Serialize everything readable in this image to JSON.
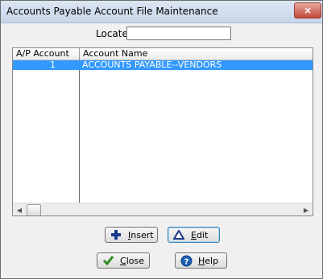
{
  "window": {
    "title": "Accounts Payable Account File Maintenance",
    "close_glyph": "×"
  },
  "locate": {
    "label": "Locate:",
    "value": ""
  },
  "grid": {
    "columns": [
      "A/P Account",
      "Account Name"
    ],
    "rows": [
      {
        "account": "1",
        "name": "ACCOUNTS PAYABLE--VENDORS",
        "selected": true
      }
    ],
    "scroll_left_glyph": "◀",
    "scroll_right_glyph": "▶"
  },
  "buttons": {
    "insert": {
      "first": "I",
      "rest": "nsert",
      "icon": "plus-icon"
    },
    "edit": {
      "first": "E",
      "rest": "dit",
      "icon": "triangle-icon"
    },
    "close": {
      "first": "C",
      "rest": "lose",
      "icon": "checkmark-icon"
    },
    "help": {
      "first": "H",
      "rest": "elp",
      "icon": "question-icon"
    }
  },
  "colors": {
    "selection": "#3399ff",
    "plus": "#1a3a8f",
    "check": "#2e8b1f",
    "help": "#1e5fb4"
  }
}
